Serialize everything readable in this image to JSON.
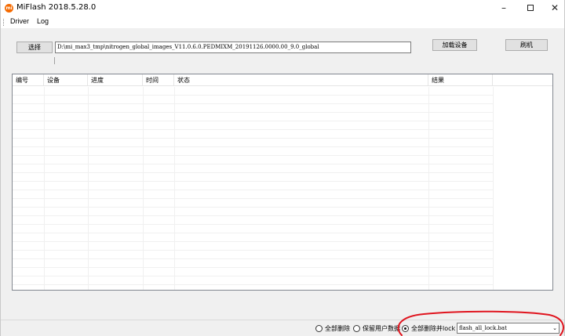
{
  "window": {
    "title": "MiFlash 2018.5.28.0",
    "logo_text": "mi",
    "min_glyph": "–",
    "close_glyph": "✕"
  },
  "menu": {
    "items": [
      {
        "label": "Driver"
      },
      {
        "label": "Log"
      }
    ]
  },
  "toolbar": {
    "select_label": "选择",
    "path_value": "D:\\mi_max3_tmp\\nitrogen_global_images_V11.0.6.0.PEDMIXM_20191126.0000.00_9.0_global",
    "load_device_label": "加载设备",
    "flash_label": "刷机"
  },
  "table": {
    "columns": [
      {
        "label": "编号"
      },
      {
        "label": "设备"
      },
      {
        "label": "进度"
      },
      {
        "label": "时间"
      },
      {
        "label": "状态"
      },
      {
        "label": "结果"
      }
    ]
  },
  "footer": {
    "options": [
      {
        "label": "全部删除",
        "selected": false
      },
      {
        "label": "保留用户数据",
        "selected": false
      },
      {
        "label": "全部删除并lock",
        "selected": true
      }
    ],
    "script_value": "flash_all_lock.bat",
    "chevron_glyph": "⌄"
  },
  "colors": {
    "annotation": "#e0141e",
    "logo": "#f56a00"
  }
}
